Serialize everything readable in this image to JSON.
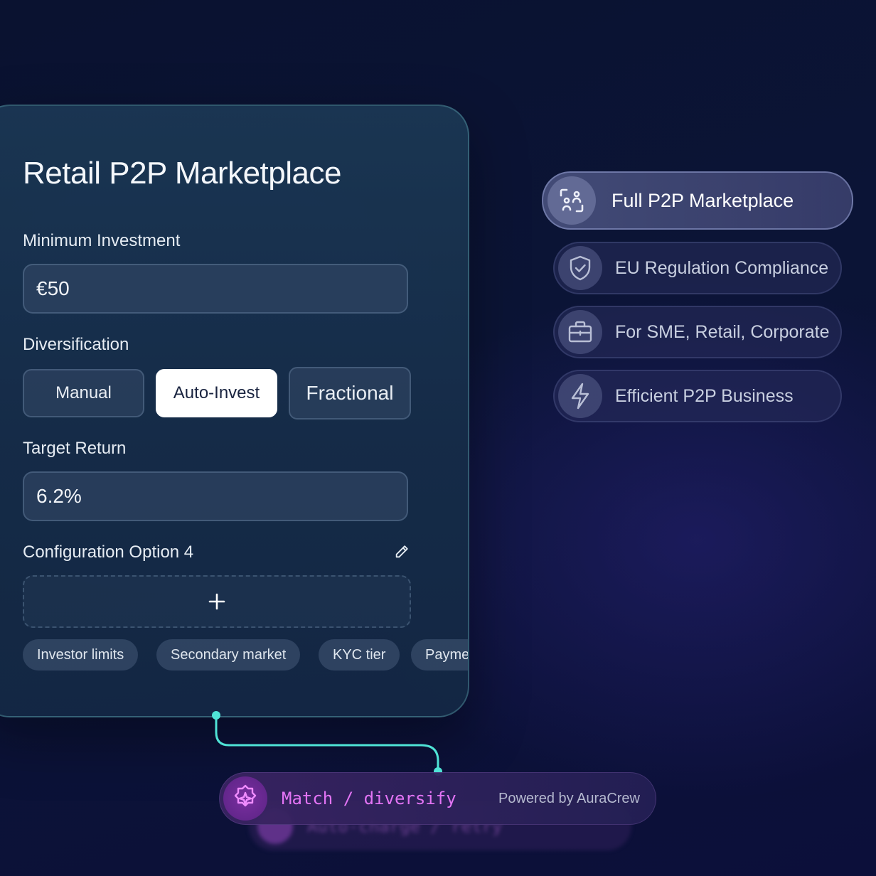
{
  "card": {
    "title": "Retail P2P Marketplace",
    "minimum_investment": {
      "label": "Minimum Investment",
      "value": "€50"
    },
    "diversification": {
      "label": "Diversification",
      "options": [
        "Manual",
        "Auto-Invest",
        "Fractional"
      ],
      "selected": "Auto-Invest"
    },
    "target_return": {
      "label": "Target Return",
      "value": "6.2%"
    },
    "config_option": {
      "label": "Configuration Option 4",
      "add_symbol": "+"
    },
    "chips": [
      "Investor limits",
      "Secondary market",
      "KYC tier",
      "Payme"
    ]
  },
  "features": [
    {
      "label": "Full P2P Marketplace",
      "icon": "users-scan-icon"
    },
    {
      "label": "EU Regulation Compliance",
      "icon": "shield-check-icon"
    },
    {
      "label": "For SME, Retail, Corporate",
      "icon": "briefcase-icon"
    },
    {
      "label": "Efficient P2P Business",
      "icon": "lightning-icon"
    }
  ],
  "action_bar": {
    "command": "Match / diversify",
    "powered_by": "Powered by AuraCrew",
    "icon": "sparkle-gear-icon",
    "ghost_command": "Auto-charge / retry"
  },
  "colors": {
    "accent_teal": "#4fe3d6",
    "accent_magenta": "#e374f5",
    "background": "#0b1436"
  }
}
